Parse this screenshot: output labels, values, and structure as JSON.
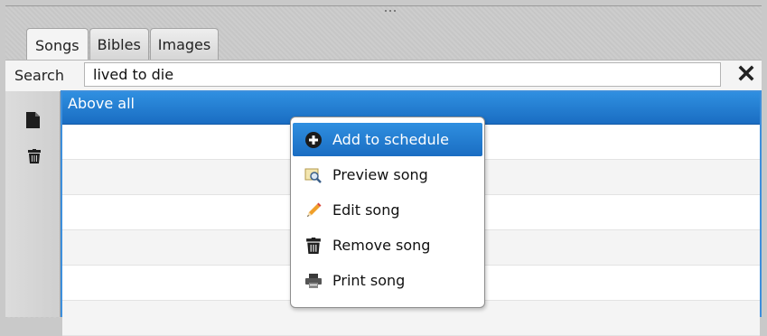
{
  "tabs": [
    {
      "label": "Songs",
      "active": true
    },
    {
      "label": "Bibles",
      "active": false
    },
    {
      "label": "Images",
      "active": false
    }
  ],
  "search": {
    "label": "Search",
    "value": "lived to die",
    "clear_icon": "close-icon"
  },
  "toolbar": {
    "new_icon": "new-document-icon",
    "delete_icon": "trash-icon"
  },
  "songs": {
    "rows": [
      {
        "title": "Above all",
        "selected": true
      },
      {
        "title": ""
      },
      {
        "title": ""
      },
      {
        "title": ""
      },
      {
        "title": ""
      },
      {
        "title": ""
      },
      {
        "title": ""
      }
    ]
  },
  "context_menu": {
    "items": [
      {
        "label": "Add to schedule",
        "icon": "add-circle-icon",
        "highlighted": true
      },
      {
        "label": "Preview song",
        "icon": "preview-icon"
      },
      {
        "label": "Edit song",
        "icon": "pencil-icon"
      },
      {
        "label": "Remove song",
        "icon": "trash-icon"
      },
      {
        "label": "Print song",
        "icon": "printer-icon"
      }
    ]
  },
  "colors": {
    "accent": "#2a82d8",
    "selection_text": "#ffffff"
  }
}
